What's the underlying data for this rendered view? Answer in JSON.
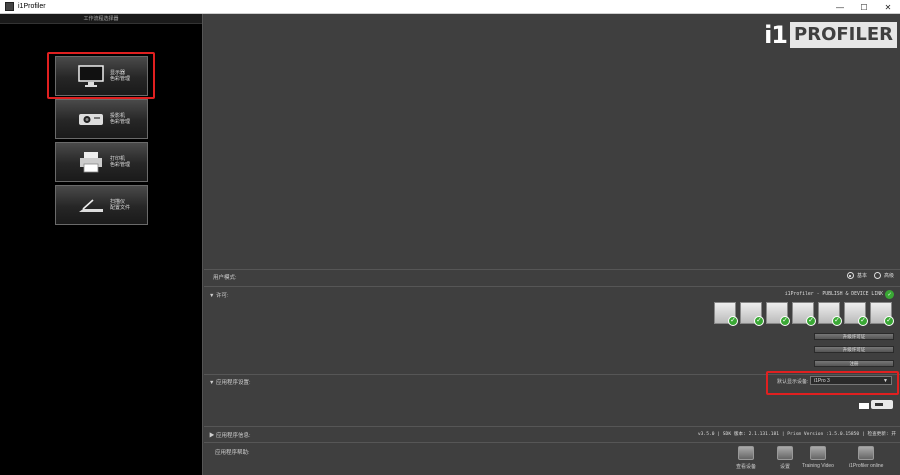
{
  "window": {
    "title": "i1Profiler",
    "minimize_glyph": "—",
    "maximize_glyph": "☐",
    "close_glyph": "✕"
  },
  "left_panel": {
    "header": "工作流程选择器",
    "workflows": [
      {
        "name": "display",
        "line1": "显示器",
        "line2": "色彩管理",
        "icon": "monitor-icon"
      },
      {
        "name": "projector",
        "line1": "投影机",
        "line2": "色彩管理",
        "icon": "projector-icon"
      },
      {
        "name": "printer",
        "line1": "打印机",
        "line2": "色彩管理",
        "icon": "printer-icon"
      },
      {
        "name": "scanner",
        "line1": "扫描仪",
        "line2": "配置文件",
        "icon": "scanner-icon"
      }
    ]
  },
  "logo": {
    "part1": "i1",
    "part2": "PROFILER"
  },
  "user_mode": {
    "label": "用户模式:",
    "options": [
      {
        "label": "基本",
        "selected": true
      },
      {
        "label": "高级",
        "selected": false
      }
    ]
  },
  "license": {
    "label": "▼ 许可:",
    "status_text": "i1Profiler - PUBLISH & DEVICE LINK",
    "devices": [
      "monitor-icon",
      "monitor-edit-icon",
      "projector-icon",
      "printer-icon",
      "printer-icon",
      "printer-icon",
      "scanner-icon"
    ],
    "buttons": [
      "升级许可证",
      "升级许可证",
      "注册"
    ]
  },
  "app_settings": {
    "label": "▼ 应用程序设置:",
    "default_device_label": "默认显示设备:",
    "default_device_value": "i1Pro 3"
  },
  "app_info": {
    "label": "▶ 应用程序信息:",
    "text": "v3.5.0 | SDK 版本: 2.1.131.181 | Prism Version :1.5.0.15850 | 检查更新: 开"
  },
  "app_help": {
    "label": "应用程序帮助:",
    "items": [
      {
        "label": "查看设备",
        "icon": "device-icon"
      },
      {
        "label": "设置",
        "icon": "gear-icon"
      },
      {
        "label": "Training Video",
        "icon": "video-icon"
      },
      {
        "label": "i1Profiler online",
        "icon": "globe-icon"
      }
    ]
  },
  "colors": {
    "highlight": "#e02020",
    "check_green": "#3aa835"
  }
}
